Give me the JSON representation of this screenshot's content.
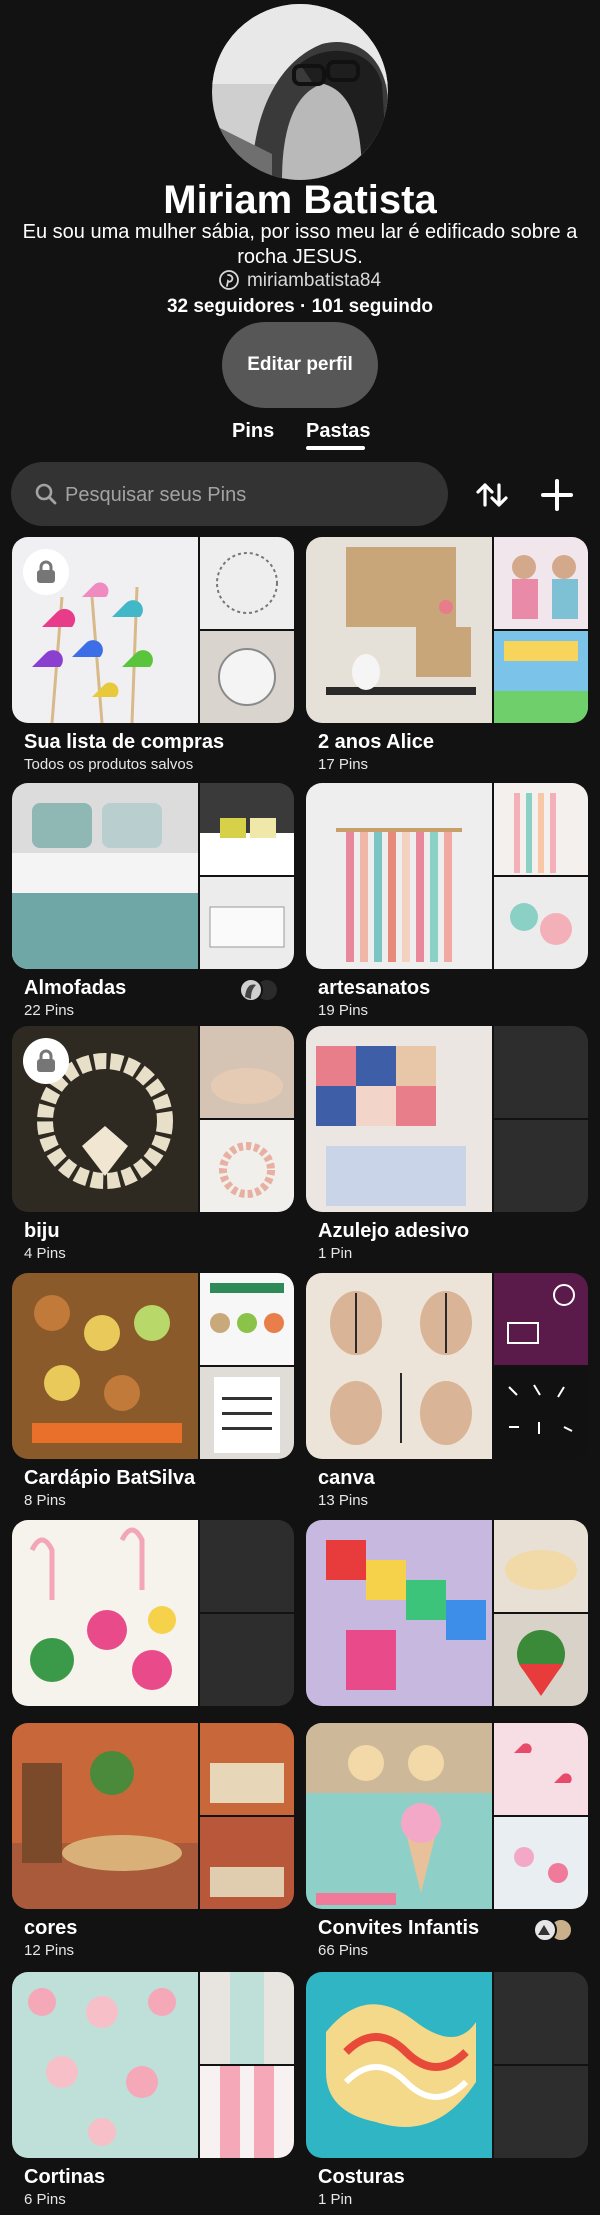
{
  "profile": {
    "name": "Miriam Batista",
    "bio": "Eu sou uma mulher sábia, por isso meu lar é edificado sobre a rocha JESUS.",
    "handle": "miriambatista84",
    "stats": "32 seguidores · 101 seguindo",
    "edit_label": "Editar perfil"
  },
  "tabs": {
    "pins": "Pins",
    "boards": "Pastas",
    "active": "Pastas"
  },
  "search": {
    "placeholder": "Pesquisar seus Pins"
  },
  "icons": {
    "avatar": "profile-photo",
    "handle": "pinterest-logo-icon",
    "search": "search-icon",
    "sort": "sort-arrows-icon",
    "add": "plus-icon",
    "lock": "lock-icon"
  },
  "colors": {
    "background": "#121212",
    "button": "#575757",
    "search": "#333333",
    "empty_tile": "#2d2d2d"
  },
  "boards": [
    {
      "title": "Sua lista de compras",
      "subtitle": "Todos os produtos salvos",
      "secret": true
    },
    {
      "title": "2 anos Alice",
      "subtitle": "17 Pins"
    },
    {
      "title": "Almofadas",
      "subtitle": "22 Pins",
      "collaborators": true
    },
    {
      "title": "artesanatos",
      "subtitle": "19 Pins"
    },
    {
      "title": "biju",
      "subtitle": "4 Pins",
      "secret": true
    },
    {
      "title": "Azulejo adesivo",
      "subtitle": "1 Pin"
    },
    {
      "title": "Cardápio BatSilva",
      "subtitle": "8 Pins"
    },
    {
      "title": "canva",
      "subtitle": "13 Pins"
    },
    {
      "title": "",
      "subtitle": ""
    },
    {
      "title": "",
      "subtitle": ""
    },
    {
      "title": "cores",
      "subtitle": "12 Pins"
    },
    {
      "title": "Convites Infantis",
      "subtitle": "66 Pins",
      "collaborators": true
    },
    {
      "title": "Cortinas",
      "subtitle": "6 Pins"
    },
    {
      "title": "Costuras",
      "subtitle": "1 Pin"
    }
  ]
}
